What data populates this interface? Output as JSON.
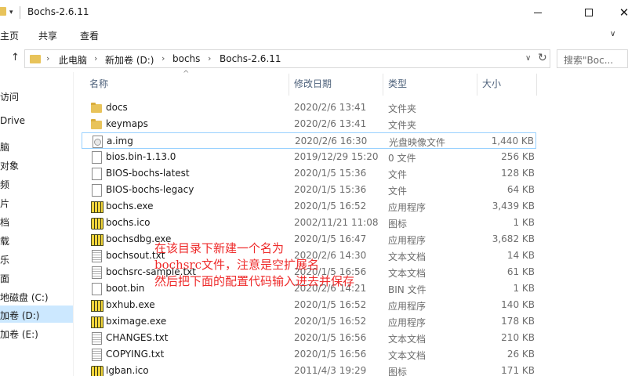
{
  "window": {
    "title": "Bochs-2.6.11",
    "quick_access_dropdown": "▾"
  },
  "ribbon": {
    "tabs": [
      "主页",
      "共享",
      "查看"
    ]
  },
  "address_bar": {
    "breadcrumbs": [
      "此电脑",
      "新加卷 (D:)",
      "bochs",
      "Bochs-2.6.11"
    ],
    "search_placeholder": "搜索\"Boc..."
  },
  "nav_pane": {
    "items": [
      "访问",
      "Drive",
      "脑",
      "对象",
      "频",
      "片",
      "档",
      "载",
      "乐",
      "面",
      "地磁盘 (C:)",
      "加卷 (D:)",
      "加卷 (E:)"
    ],
    "selected_index": 11
  },
  "columns": {
    "name": "名称",
    "date": "修改日期",
    "type": "类型",
    "size": "大小"
  },
  "files": [
    {
      "name": "docs",
      "date": "2020/2/6 13:41",
      "type": "文件夹",
      "size": "",
      "icon": "folder-icon"
    },
    {
      "name": "keymaps",
      "date": "2020/2/6 13:41",
      "type": "文件夹",
      "size": "",
      "icon": "folder-icon"
    },
    {
      "name": "a.img",
      "date": "2020/2/6 16:30",
      "type": "光盘映像文件",
      "size": "1,440 KB",
      "icon": "disc-image-icon"
    },
    {
      "name": "bios.bin-1.13.0",
      "date": "2019/12/29 15:20",
      "type": "0 文件",
      "size": "256 KB",
      "icon": "file-icon"
    },
    {
      "name": "BIOS-bochs-latest",
      "date": "2020/1/5 15:36",
      "type": "文件",
      "size": "128 KB",
      "icon": "file-icon"
    },
    {
      "name": "BIOS-bochs-legacy",
      "date": "2020/1/5 15:36",
      "type": "文件",
      "size": "64 KB",
      "icon": "file-icon"
    },
    {
      "name": "bochs.exe",
      "date": "2020/1/5 16:52",
      "type": "应用程序",
      "size": "3,439 KB",
      "icon": "app-icon"
    },
    {
      "name": "bochs.ico",
      "date": "2002/11/21 11:08",
      "type": "图标",
      "size": "1 KB",
      "icon": "ico-icon"
    },
    {
      "name": "bochsdbg.exe",
      "date": "2020/1/5 16:47",
      "type": "应用程序",
      "size": "3,682 KB",
      "icon": "app-icon"
    },
    {
      "name": "bochsout.txt",
      "date": "2020/2/6 14:30",
      "type": "文本文档",
      "size": "14 KB",
      "icon": "text-file-icon"
    },
    {
      "name": "bochsrc-sample.txt",
      "date": "2020/1/5 16:56",
      "type": "文本文档",
      "size": "61 KB",
      "icon": "text-file-icon"
    },
    {
      "name": "boot.bin",
      "date": "2020/2/6 14:21",
      "type": "BIN 文件",
      "size": "1 KB",
      "icon": "file-icon"
    },
    {
      "name": "bxhub.exe",
      "date": "2020/1/5 16:52",
      "type": "应用程序",
      "size": "140 KB",
      "icon": "app-icon"
    },
    {
      "name": "bximage.exe",
      "date": "2020/1/5 16:52",
      "type": "应用程序",
      "size": "178 KB",
      "icon": "app-icon"
    },
    {
      "name": "CHANGES.txt",
      "date": "2020/1/5 16:56",
      "type": "文本文档",
      "size": "210 KB",
      "icon": "text-file-icon"
    },
    {
      "name": "COPYING.txt",
      "date": "2020/1/5 16:56",
      "type": "文本文档",
      "size": "26 KB",
      "icon": "text-file-icon"
    },
    {
      "name": "lgban.ico",
      "date": "2011/4/3 19:29",
      "type": "图标",
      "size": "171 KB",
      "icon": "ico-icon"
    }
  ],
  "annotation": {
    "lines": [
      "在该目录下新建一个名为",
      "bochsrc文件，注意是空扩展名",
      "然后把下面的配置代码输入进去并保存"
    ],
    "color": "#ee2a2a"
  }
}
